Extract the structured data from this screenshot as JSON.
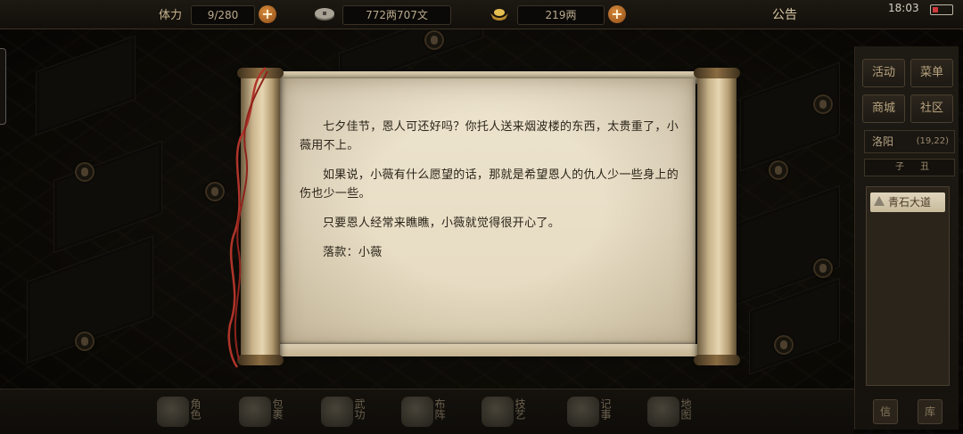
{
  "topbar": {
    "stamina_label": "体力",
    "stamina_value": "9/280",
    "copper_value": "772两707文",
    "silver_value": "219两",
    "notice": "公告",
    "time": "18:03",
    "icons": [
      "plus-icon",
      "coin-icon",
      "ingot-icon",
      "battery-icon"
    ]
  },
  "right_panel": {
    "buttons": [
      "活动",
      "菜单",
      "商城",
      "社区"
    ],
    "city": "洛阳",
    "coords": "(19,22)",
    "hours": [
      "子",
      "丑"
    ],
    "location": "青石大道",
    "small_buttons": [
      "信",
      "库"
    ]
  },
  "bottom_bar": {
    "items": [
      "角色",
      "包裹",
      "武功",
      "布阵",
      "技艺",
      "记事",
      "地图"
    ]
  },
  "letter": {
    "paragraphs": [
      "七夕佳节，恩人可还好吗？你托人送来烟波楼的东西，太贵重了，小薇用不上。",
      "如果说，小薇有什么愿望的话，那就是希望恩人的仇人少一些身上的伤也少一些。",
      "只要恩人经常来瞧瞧，小薇就觉得很开心了。",
      "落款：小薇"
    ]
  }
}
